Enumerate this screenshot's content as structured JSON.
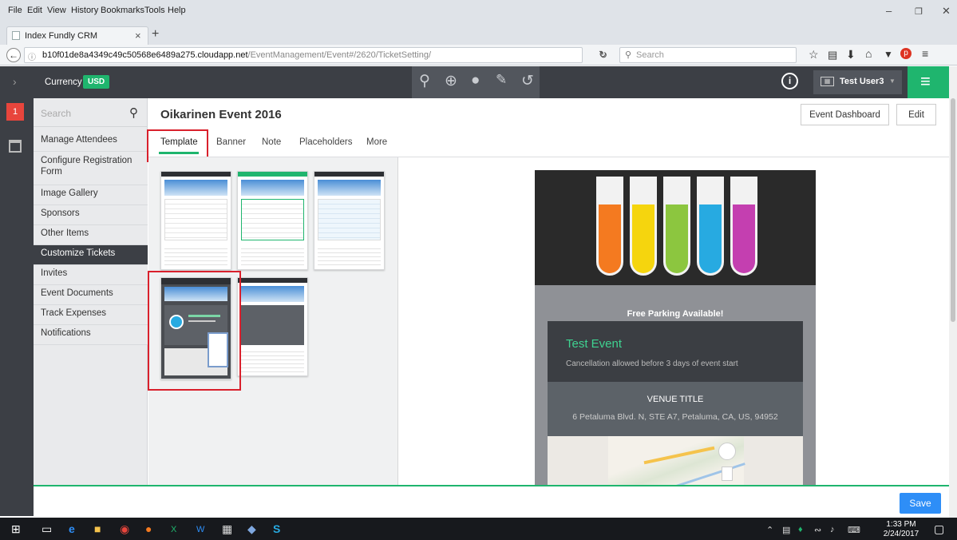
{
  "browser": {
    "menu": [
      "File",
      "Edit",
      "View",
      "History",
      "Bookmarks",
      "Tools",
      "Help"
    ],
    "tab_title": "Index Fundly CRM",
    "url_host": "b10f01de8a4349c49c50568e6489a275.cloudapp.net",
    "url_path": "/EventManagement/Event#/2620/TicketSetting/",
    "search_placeholder": "Search"
  },
  "header": {
    "currency_label": "Currency",
    "currency_value": "USD",
    "user_name": "Test User3"
  },
  "rail": {
    "badge": "1"
  },
  "sidebar": {
    "search_placeholder": "Search",
    "items": [
      {
        "label": "Manage Attendees"
      },
      {
        "label": "Configure Registration Form"
      },
      {
        "label": "Image Gallery"
      },
      {
        "label": "Sponsors"
      },
      {
        "label": "Other Items"
      },
      {
        "label": "Customize Tickets"
      },
      {
        "label": "Invites"
      },
      {
        "label": "Event Documents"
      },
      {
        "label": "Track Expenses"
      },
      {
        "label": "Notifications"
      }
    ]
  },
  "main": {
    "title": "Oikarinen Event 2016",
    "dashboard_button": "Event Dashboard",
    "edit_button": "Edit",
    "tabs": [
      "Template",
      "Banner",
      "Note",
      "Placeholders",
      "More"
    ]
  },
  "preview": {
    "parking": "Free Parking Available!",
    "event_name": "Test Event",
    "cancellation": "Cancellation allowed before 3 days of event start",
    "venue_title": "VENUE TITLE",
    "venue_address": "6 Petaluma Blvd. N, STE A7, Petaluma, CA, US, 94952",
    "tube_colors": [
      "#f47a20",
      "#f5d50e",
      "#8cc63f",
      "#27aae1",
      "#c43fb0"
    ]
  },
  "footer": {
    "save_label": "Save"
  },
  "taskbar": {
    "time": "1:33 PM",
    "date": "2/24/2017"
  }
}
